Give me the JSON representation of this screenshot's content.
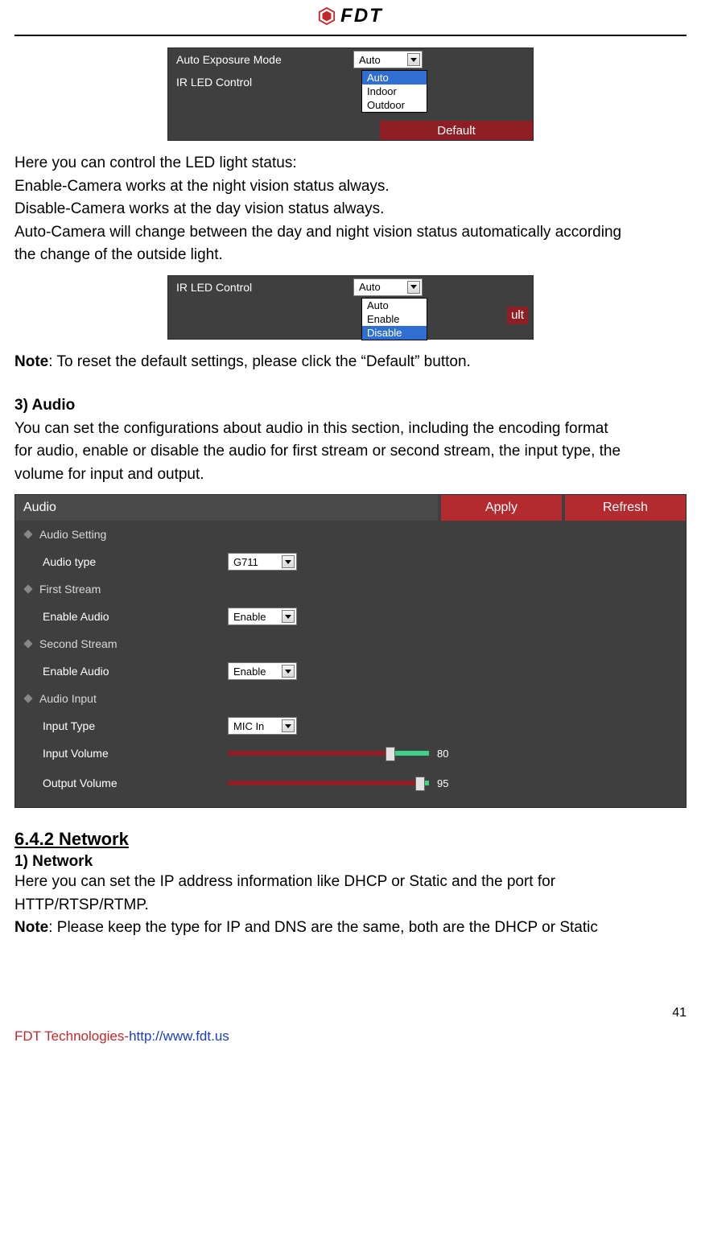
{
  "header": {
    "brand": "FDT"
  },
  "panel1": {
    "label_exposure": "Auto Exposure Mode",
    "label_ir": "IR LED Control",
    "selected": "Auto",
    "options": [
      "Auto",
      "Indoor",
      "Outdoor"
    ],
    "default_btn": "Default"
  },
  "text_block1": {
    "l1": "Here you can control the LED light status:",
    "l2": "Enable-Camera works at the night vision status always.",
    "l3": "Disable-Camera works at the day vision status always.",
    "l4": "Auto-Camera will change between the day and night vision status automatically according",
    "l5": "the change of the outside light."
  },
  "panel2": {
    "label": "IR LED Control",
    "selected": "Auto",
    "options": [
      "Auto",
      "Enable",
      "Disable"
    ],
    "default_partial": "ult"
  },
  "note1_bold": "Note",
  "note1_rest": ": To reset the default settings, please click the “Default” button.",
  "section3_title": "3) Audio",
  "section3_text": {
    "l1": "You can set the configurations about audio in this section, including the encoding format",
    "l2": "for audio, enable or disable the audio for first stream or second stream, the input type, the",
    "l3": "volume for input and output."
  },
  "audio": {
    "title": "Audio",
    "apply": "Apply",
    "refresh": "Refresh",
    "section_audio_setting": "Audio Setting",
    "label_audio_type": "Audio type",
    "value_audio_type": "G711",
    "section_first": "First Stream",
    "label_enable1": "Enable Audio",
    "value_enable1": "Enable",
    "section_second": "Second Stream",
    "label_enable2": "Enable Audio",
    "value_enable2": "Enable",
    "section_input": "Audio Input",
    "label_input_type": "Input Type",
    "value_input_type": "MIC In",
    "label_input_vol": "Input Volume",
    "value_input_vol": "80",
    "label_output_vol": "Output Volume",
    "value_output_vol": "95"
  },
  "heading_network": "6.4.2 Network",
  "sub_network": "1) Network",
  "network_text": {
    "l1": "Here you can set the IP address information like DHCP or Static and the port for",
    "l2": "HTTP/RTSP/RTMP."
  },
  "note2_bold": "Note",
  "note2_rest": ": Please keep the type for IP and DNS are the same, both are the DHCP or Static",
  "footer": {
    "company": "FDT Technologies-",
    "url": "http://www.fdt.us",
    "page": "41"
  }
}
